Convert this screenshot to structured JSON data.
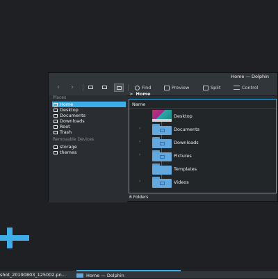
{
  "window": {
    "title": "Home — Dolphin"
  },
  "toolbar": {
    "find": "Find",
    "preview": "Preview",
    "split": "Split",
    "control": "Control"
  },
  "places": {
    "header": "Places",
    "items": [
      {
        "label": "Home",
        "icon": "home-icon",
        "selected": true
      },
      {
        "label": "Desktop",
        "icon": "desktop-icon"
      },
      {
        "label": "Documents",
        "icon": "documents-icon"
      },
      {
        "label": "Downloads",
        "icon": "downloads-icon"
      },
      {
        "label": "Root",
        "icon": "root-icon"
      },
      {
        "label": "Trash",
        "icon": "trash-icon"
      }
    ],
    "removable_header": "Removable Devices",
    "removable": [
      {
        "label": "storage",
        "icon": "drive-icon"
      },
      {
        "label": "themes",
        "icon": "drive-icon"
      }
    ]
  },
  "breadcrumb": {
    "separator": ">",
    "current": "Home"
  },
  "view": {
    "column_header": "Name",
    "items": [
      {
        "name": "Desktop",
        "type": "desktop"
      },
      {
        "name": "Documents",
        "type": "folder"
      },
      {
        "name": "Downloads",
        "type": "folder"
      },
      {
        "name": "Pictures",
        "type": "folder"
      },
      {
        "name": "Templates",
        "type": "folder"
      },
      {
        "name": "Videos",
        "type": "folder"
      }
    ]
  },
  "status": {
    "text": "6 Folders"
  },
  "taskbar": {
    "tasks": [
      {
        "label": "shot_20190803_125002.pn..."
      },
      {
        "label": "Home — Dolphin",
        "active": true
      }
    ]
  },
  "colors": {
    "accent": "#3daee9",
    "folder": "#64a8e0",
    "window_bg": "#2a2e32",
    "desktop_bg": "#1f2023"
  }
}
